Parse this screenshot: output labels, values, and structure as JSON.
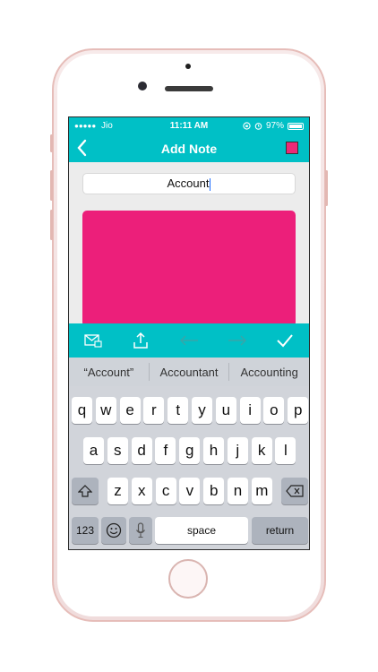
{
  "status_bar": {
    "signal": "●●●●●",
    "carrier": "Jio",
    "time": "11:11 AM",
    "battery_percent": "97%",
    "battery_level": 0.97
  },
  "nav": {
    "title": "Add Note",
    "back_icon": "chevron-left-icon",
    "color_swatch": "#ec2a77"
  },
  "note": {
    "title_value": "Account",
    "color": "#ec1f7a"
  },
  "toolbar": {
    "icons": [
      "mail-icon",
      "share-icon",
      "arrow-left-icon",
      "arrow-right-icon",
      "checkmark-icon"
    ]
  },
  "suggestions": [
    "“Account”",
    "Accountant",
    "Accounting"
  ],
  "keyboard": {
    "row1": [
      "q",
      "w",
      "e",
      "r",
      "t",
      "y",
      "u",
      "i",
      "o",
      "p"
    ],
    "row2": [
      "a",
      "s",
      "d",
      "f",
      "g",
      "h",
      "j",
      "k",
      "l"
    ],
    "row3": [
      "z",
      "x",
      "c",
      "v",
      "b",
      "n",
      "m"
    ],
    "numbers_label": "123",
    "space_label": "space",
    "return_label": "return"
  },
  "colors": {
    "accent": "#00c0c6",
    "note_pink": "#ec1f7a"
  }
}
